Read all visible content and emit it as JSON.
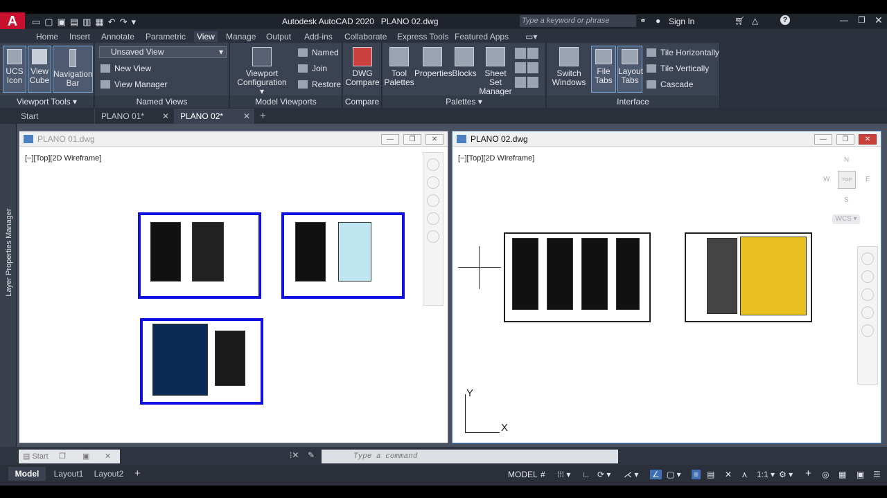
{
  "app": {
    "title": "Autodesk AutoCAD 2020",
    "file": "PLANO 02.dwg",
    "search_placeholder": "Type a keyword or phrase",
    "sign_in": "Sign In",
    "logo": "A"
  },
  "ribbon": {
    "tabs": [
      "Home",
      "Insert",
      "Annotate",
      "Parametric",
      "View",
      "Manage",
      "Output",
      "Add-ins",
      "Collaborate",
      "Express Tools",
      "Featured Apps"
    ],
    "active_tab": "View",
    "viewport_tools": {
      "title": "Viewport Tools",
      "ucs": [
        "UCS",
        "Icon"
      ],
      "cube": [
        "View",
        "Cube"
      ],
      "nav": [
        "Navigation",
        "Bar"
      ]
    },
    "named_views": {
      "title": "Named Views",
      "dropdown": "Unsaved View",
      "new_view": "New View",
      "view_manager": "View Manager"
    },
    "model_viewports": {
      "title": "Model Viewports",
      "config": [
        "Viewport",
        "Configuration"
      ],
      "named": "Named",
      "join": "Join",
      "restore": "Restore"
    },
    "compare": {
      "title": "Compare",
      "btn": [
        "DWG",
        "Compare"
      ]
    },
    "palettes": {
      "title": "Palettes",
      "tool": [
        "Tool",
        "Palettes"
      ],
      "properties": "Properties",
      "blocks": "Blocks",
      "sheetset": [
        "Sheet Set",
        "Manager"
      ]
    },
    "interface": {
      "title": "Interface",
      "switch": [
        "Switch",
        "Windows"
      ],
      "filetabs": [
        "File",
        "Tabs"
      ],
      "layouttabs": [
        "Layout",
        "Tabs"
      ],
      "tile_h": "Tile Horizontally",
      "tile_v": "Tile Vertically",
      "cascade": "Cascade"
    }
  },
  "file_tabs": [
    {
      "label": "Start"
    },
    {
      "label": "PLANO 01*"
    },
    {
      "label": "PLANO 02*"
    }
  ],
  "side_palette": "Layer Properties Manager",
  "windows": [
    {
      "title": "PLANO 01.dwg",
      "viewport_label": "[−][Top][2D Wireframe]"
    },
    {
      "title": "PLANO 02.dwg",
      "viewport_label": "[−][Top][2D Wireframe]"
    }
  ],
  "viewcube": {
    "n": "N",
    "s": "S",
    "e": "E",
    "w": "W",
    "top": "TOP",
    "wcs": "WCS"
  },
  "ucs": {
    "x": "X",
    "y": "Y"
  },
  "minimized": {
    "label": "Start"
  },
  "command": {
    "placeholder": "Type a command"
  },
  "status": {
    "layouts": [
      "Model",
      "Layout1",
      "Layout2"
    ],
    "model": "MODEL",
    "scale": "1:1"
  },
  "colors": {
    "accent": "#4a90d9",
    "sheet_border": "#1010e0",
    "ribbon_bg": "#2b313d"
  }
}
